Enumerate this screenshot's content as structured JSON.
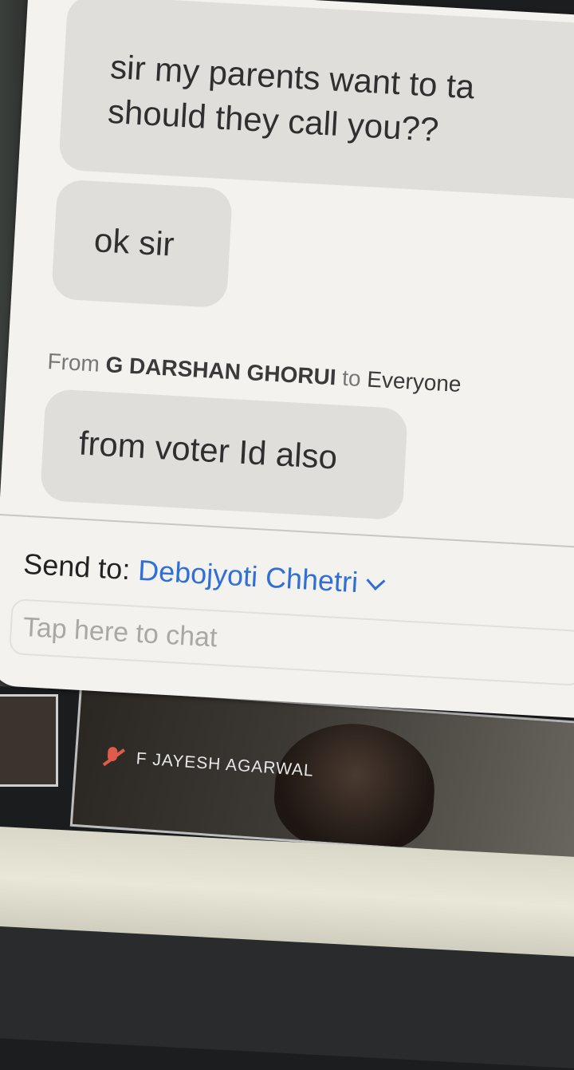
{
  "chat": {
    "messages": [
      {
        "text": "sir my parents want to ta\nshould they call you??"
      },
      {
        "text": "ok sir"
      },
      {
        "from_prefix": "From",
        "sender": "G DARSHAN GHORUI",
        "to_prefix": "to",
        "recipient": "Everyone",
        "text": "from voter Id also"
      }
    ],
    "send_to_label": "Send to:",
    "send_to_value": "Debojyoti Chhetri",
    "input_placeholder": "Tap here to chat"
  },
  "video": {
    "participant_name": "F JAYESH AGARWAL"
  },
  "colors": {
    "accent_link": "#2f6fd6",
    "muted_icon": "#e15b4a",
    "bubble": "#dfdedb"
  },
  "icons": [
    "chevron-down-icon",
    "mic-muted-icon"
  ]
}
